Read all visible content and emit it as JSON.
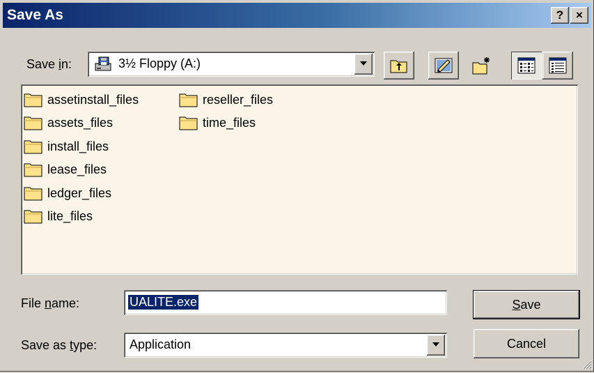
{
  "window": {
    "title": "Save As",
    "help_label": "?",
    "close_label": "×"
  },
  "save_in": {
    "label_pre": "Save ",
    "label_accel": "i",
    "label_post": "n:",
    "value": "3½ Floppy (A:)"
  },
  "toolbar": {
    "icons": [
      "up-one-level-icon",
      "desktop-icon",
      "new-folder-icon",
      "list-view-icon",
      "details-view-icon"
    ]
  },
  "files": {
    "col1": [
      "assetinstall_files",
      "assets_files",
      "install_files",
      "lease_files",
      "ledger_files",
      "lite_files"
    ],
    "col2": [
      "reseller_files",
      "time_files"
    ]
  },
  "file_name": {
    "label_pre": "File ",
    "label_accel": "n",
    "label_post": "ame:",
    "value": "UALITE.exe"
  },
  "save_as_type": {
    "label_pre": "Save as ",
    "label_accel": "t",
    "label_post": "ype:",
    "value": "Application"
  },
  "buttons": {
    "save_accel": "S",
    "save_rest": "ave",
    "cancel": "Cancel"
  }
}
